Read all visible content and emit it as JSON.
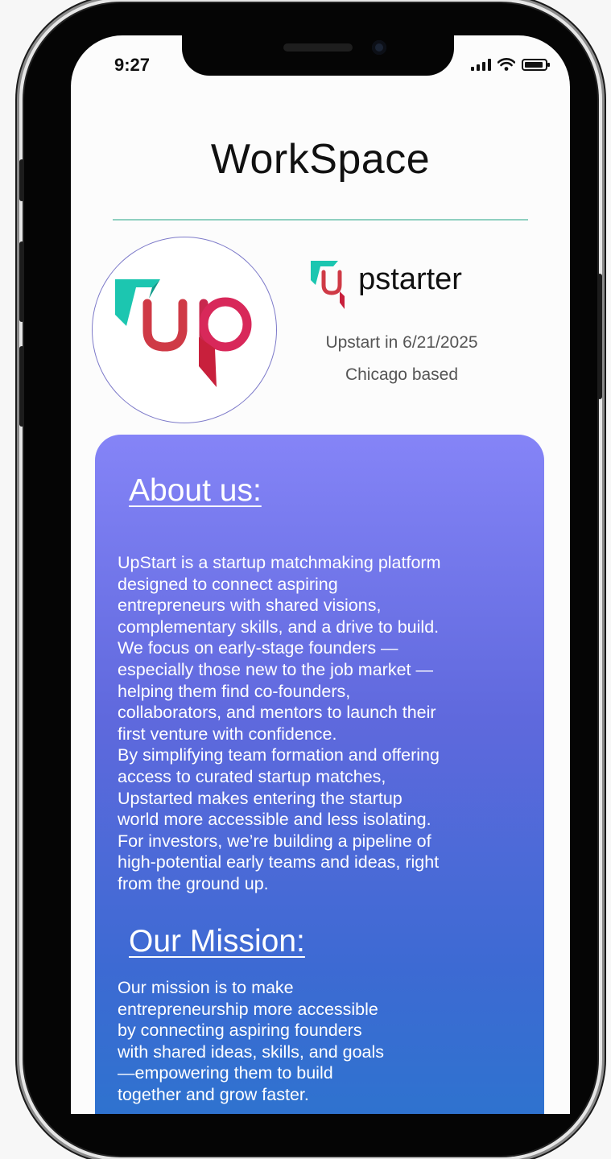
{
  "status_bar": {
    "time": "9:27",
    "battery_level": 0.9
  },
  "header": {
    "title": "WorkSpace"
  },
  "brand": {
    "logo_text": "up",
    "wordmark_accent": "u",
    "wordmark_rest": "pstarter"
  },
  "company_info": {
    "founded": "Upstart in 6/21/2025",
    "location": "Chicago based"
  },
  "about": {
    "heading": "About us:",
    "body": "UpStart is a startup matchmaking platform\ndesigned to connect aspiring\nentrepreneurs with shared visions,\ncomplementary skills, and a drive to build.\nWe focus on early-stage founders —\nespecially those new to the job market —\nhelping them find co-founders,\ncollaborators, and mentors to launch their\nfirst venture with confidence.\nBy simplifying team formation and offering\naccess to curated startup matches,\nUpstarted makes entering the startup\nworld more accessible and less isolating.\nFor investors, we’re building a pipeline of\nhigh-potential early teams and ideas, right\nfrom the ground up."
  },
  "mission": {
    "heading": "Our Mission:",
    "body": "Our mission is to make\nentrepreneurship more accessible\nby connecting aspiring founders\nwith shared ideas, skills, and goals\n—empowering them to build\ntogether and grow faster."
  },
  "colors": {
    "teal": "#1cc6b0",
    "brand_red": "#d0344a",
    "card_top": "#8584f7",
    "card_bottom": "#2c74ce"
  }
}
